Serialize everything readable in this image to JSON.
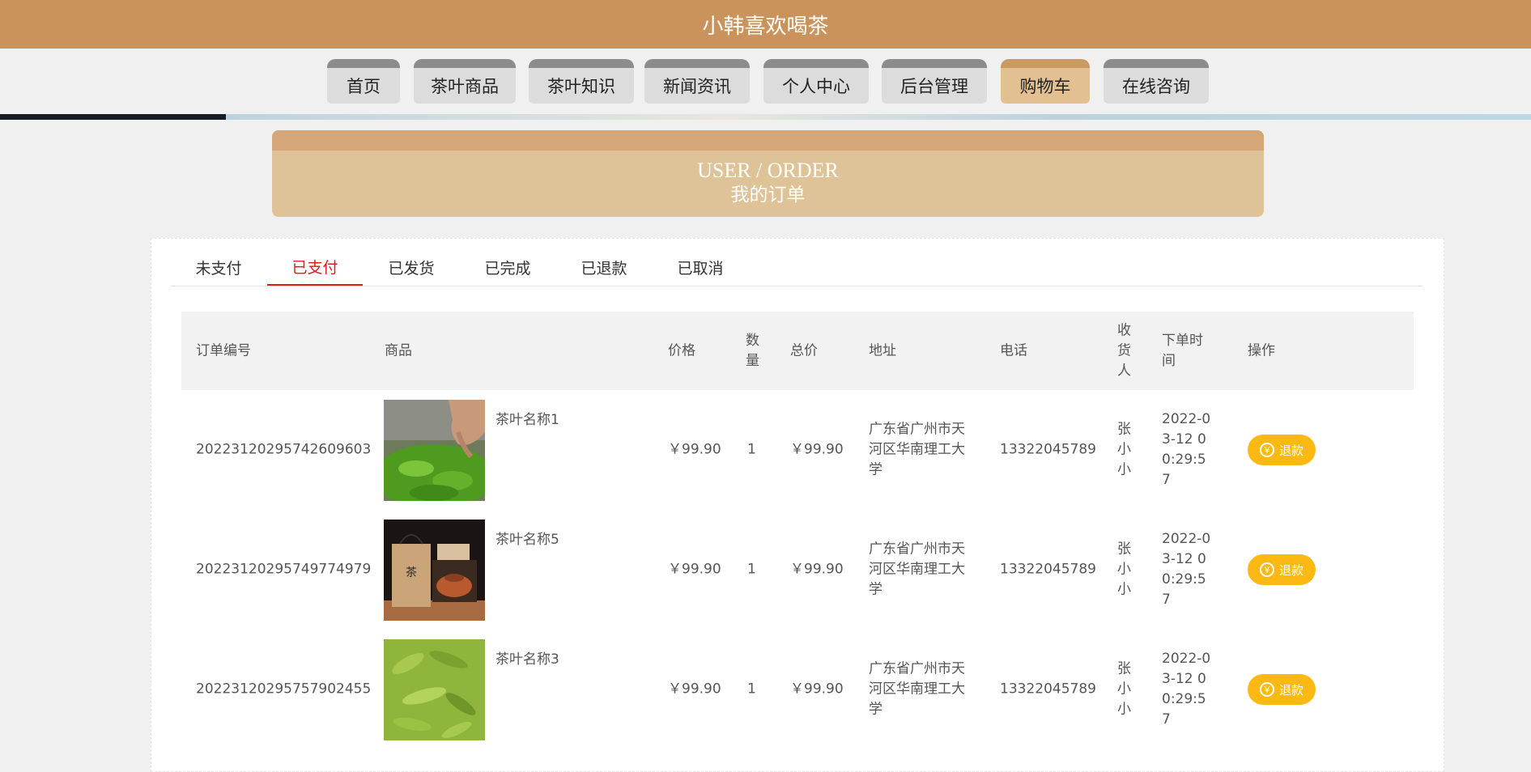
{
  "site": {
    "title": "小韩喜欢喝茶"
  },
  "nav": {
    "items": [
      {
        "label": "首页",
        "active": false
      },
      {
        "label": "茶叶商品",
        "active": false
      },
      {
        "label": "茶叶知识",
        "active": false
      },
      {
        "label": "新闻资讯",
        "active": false
      },
      {
        "label": "个人中心",
        "active": false
      },
      {
        "label": "后台管理",
        "active": false
      },
      {
        "label": "购物车",
        "active": true
      },
      {
        "label": "在线咨询",
        "active": false
      }
    ]
  },
  "banner": {
    "en": "USER / ORDER",
    "zh": "我的订单"
  },
  "tabs": {
    "items": [
      "未支付",
      "已支付",
      "已发货",
      "已完成",
      "已退款",
      "已取消"
    ],
    "active": "已支付"
  },
  "table": {
    "headers": {
      "order_no": "订单编号",
      "product": "商品",
      "price": "价格",
      "qty": "数量",
      "total": "总价",
      "address": "地址",
      "phone": "电话",
      "receiver": "收货人",
      "time": "下单时间",
      "action": "操作"
    },
    "rows": [
      {
        "order_no": "20223120295742609603",
        "product_name": "茶叶名称1",
        "image": "tea-leaves-hand-picking-photo",
        "price": "￥99.90",
        "qty": "1",
        "total": "￥99.90",
        "address": "广东省广州市天河区华南理工大学",
        "phone": "13322045789",
        "receiver": "张小小",
        "time": "2022-03-12 00:29:57",
        "action_label": "退款"
      },
      {
        "order_no": "20223120295749774979",
        "product_name": "茶叶名称5",
        "image": "tea-gift-box-and-teapot-photo",
        "price": "￥99.90",
        "qty": "1",
        "total": "￥99.90",
        "address": "广东省广州市天河区华南理工大学",
        "phone": "13322045789",
        "receiver": "张小小",
        "time": "2022-03-12 00:29:57",
        "action_label": "退款"
      },
      {
        "order_no": "20223120295757902455",
        "product_name": "茶叶名称3",
        "image": "green-tea-leaves-photo",
        "price": "￥99.90",
        "qty": "1",
        "total": "￥99.90",
        "address": "广东省广州市天河区华南理工大学",
        "phone": "13322045789",
        "receiver": "张小小",
        "time": "2022-03-12 00:29:57",
        "action_label": "退款"
      }
    ]
  },
  "colors": {
    "header_bg": "#cb935c",
    "active_tab": "#e0191b",
    "refund_button": "#fdb913",
    "nav_active": "#e3c091"
  }
}
